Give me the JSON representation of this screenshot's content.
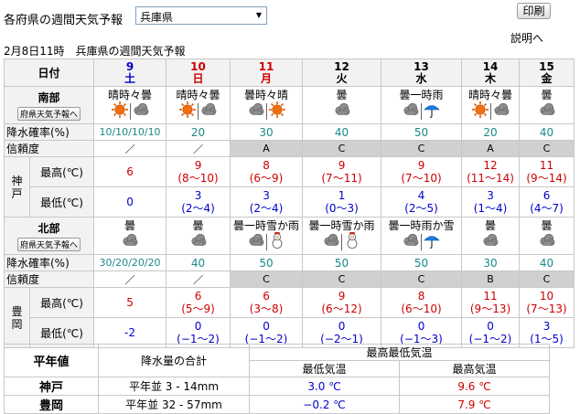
{
  "top": {
    "title": "各府県の週間天気予報",
    "selected_prefecture": "兵庫県",
    "print_label": "印刷",
    "help_label": "説明へ",
    "timestamp": "2月8日11時　兵庫県の週間天気予報"
  },
  "grid": {
    "date_label": "日付",
    "days": [
      {
        "num": "9",
        "dow": "土",
        "class": "sat"
      },
      {
        "num": "10",
        "dow": "日",
        "class": "sun"
      },
      {
        "num": "11",
        "dow": "月",
        "class": "hol"
      },
      {
        "num": "12",
        "dow": "火",
        "class": "wkd"
      },
      {
        "num": "13",
        "dow": "水",
        "class": "wkd"
      },
      {
        "num": "14",
        "dow": "木",
        "class": "wkd"
      },
      {
        "num": "15",
        "dow": "金",
        "class": "wkd"
      }
    ],
    "south": {
      "name": "南部",
      "button": "府県天気予報へ",
      "weather": [
        "晴時々曇",
        "晴時々曇",
        "曇時々晴",
        "曇",
        "曇一時雨",
        "晴時々曇",
        "曇"
      ],
      "icons": [
        [
          "sun",
          "cloud"
        ],
        [
          "sun",
          "cloud"
        ],
        [
          "cloud",
          "sun"
        ],
        [
          "cloud"
        ],
        [
          "cloud",
          "umbrella"
        ],
        [
          "sun",
          "cloud"
        ],
        [
          "cloud"
        ]
      ],
      "pop_label": "降水確率(%)",
      "pop": [
        "10/10/10/10",
        "20",
        "30",
        "40",
        "50",
        "20",
        "40"
      ],
      "reliability_label": "信頼度",
      "reliability": [
        "／",
        "／",
        "A",
        "C",
        "C",
        "A",
        "C"
      ],
      "city": "神戸",
      "max_label": "最高(℃)",
      "max": [
        [
          "6",
          ""
        ],
        [
          "9",
          "(8〜10)"
        ],
        [
          "8",
          "(6〜9)"
        ],
        [
          "9",
          "(7〜11)"
        ],
        [
          "9",
          "(7〜10)"
        ],
        [
          "12",
          "(11〜14)"
        ],
        [
          "11",
          "(9〜14)"
        ]
      ],
      "min_label": "最低(℃)",
      "min": [
        [
          "0",
          ""
        ],
        [
          "3",
          "(2〜4)"
        ],
        [
          "3",
          "(2〜4)"
        ],
        [
          "1",
          "(0〜3)"
        ],
        [
          "4",
          "(2〜5)"
        ],
        [
          "3",
          "(1〜4)"
        ],
        [
          "6",
          "(4〜7)"
        ]
      ]
    },
    "north": {
      "name": "北部",
      "button": "府県天気予報へ",
      "weather": [
        "曇",
        "曇",
        "曇一時雪か雨",
        "曇一時雪か雨",
        "曇一時雨か雪",
        "曇",
        "曇"
      ],
      "icons": [
        [
          "cloud"
        ],
        [
          "cloud"
        ],
        [
          "cloud",
          "snowman"
        ],
        [
          "cloud",
          "snowman"
        ],
        [
          "cloud",
          "umbrella"
        ],
        [
          "cloud"
        ],
        [
          "cloud"
        ]
      ],
      "pop_label": "降水確率(%)",
      "pop": [
        "30/20/20/20",
        "40",
        "50",
        "50",
        "50",
        "30",
        "40"
      ],
      "reliability_label": "信頼度",
      "reliability": [
        "／",
        "／",
        "C",
        "C",
        "C",
        "B",
        "C"
      ],
      "city": "豊岡",
      "max_label": "最高(℃)",
      "max": [
        [
          "5",
          ""
        ],
        [
          "6",
          "(5〜9)"
        ],
        [
          "6",
          "(3〜8)"
        ],
        [
          "9",
          "(6〜12)"
        ],
        [
          "8",
          "(6〜10)"
        ],
        [
          "11",
          "(9〜13)"
        ],
        [
          "10",
          "(7〜13)"
        ]
      ],
      "min_label": "最低(℃)",
      "min": [
        [
          "-2",
          ""
        ],
        [
          "0",
          "(−1〜2)"
        ],
        [
          "0",
          "(−1〜2)"
        ],
        [
          "0",
          "(−2〜1)"
        ],
        [
          "0",
          "(−1〜3)"
        ],
        [
          "0",
          "(−1〜2)"
        ],
        [
          "3",
          "(1〜5)"
        ]
      ]
    }
  },
  "summary": {
    "heading": "平年値",
    "precip_heading": "降水量の合計",
    "temp_heading": "最高最低気温",
    "min_heading": "最低気温",
    "max_heading": "最高気温",
    "rows": [
      {
        "city": "神戸",
        "precip": "平年並 3 - 14mm",
        "min": "3.0 ℃",
        "max": "9.6 ℃"
      },
      {
        "city": "豊岡",
        "precip": "平年並 32 - 57mm",
        "min": "−0.2 ℃",
        "max": "7.9 ℃"
      }
    ]
  },
  "colors": {
    "max_temp": "#cc0000",
    "min_temp": "#0000cc",
    "pop": "#1a8a8a",
    "reliability_bg": "#d0d0d0",
    "header_bg": "#f2f2f2"
  }
}
